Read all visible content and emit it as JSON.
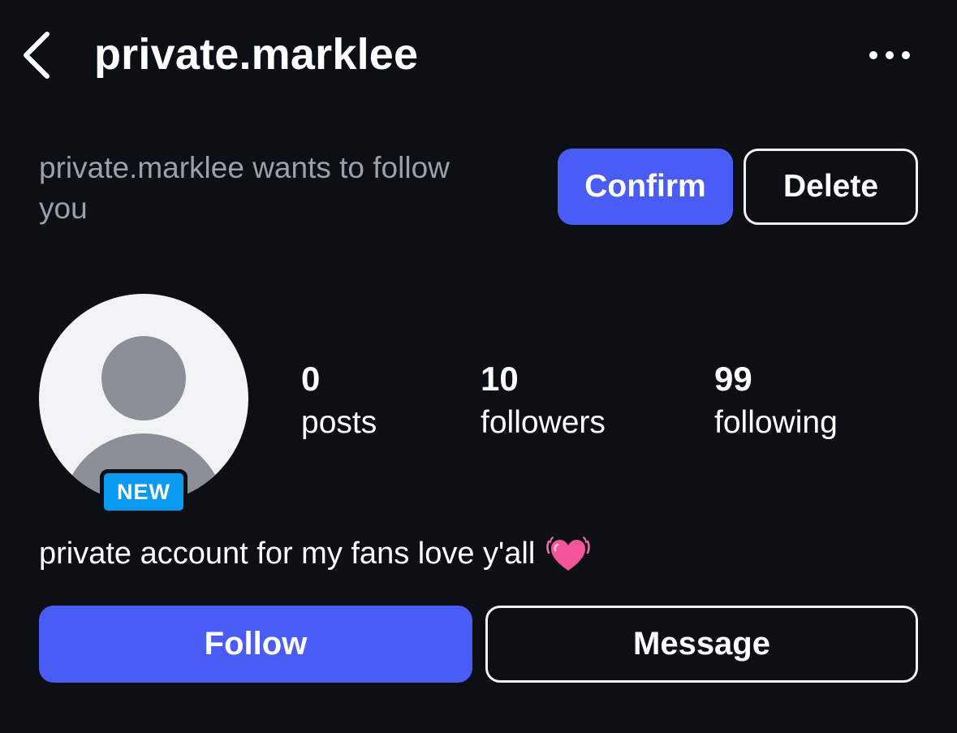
{
  "header": {
    "username": "private.marklee",
    "back_icon": "chevron-left-icon",
    "more_icon": "more-horizontal-icon"
  },
  "follow_request": {
    "text": "private.marklee wants to follow you",
    "confirm_label": "Confirm",
    "delete_label": "Delete"
  },
  "profile": {
    "avatar_icon": "default-avatar-icon",
    "new_badge": "NEW",
    "stats": {
      "posts_count": "0",
      "posts_label": "posts",
      "followers_count": "10",
      "followers_label": "followers",
      "following_count": "99",
      "following_label": "following"
    },
    "bio_text": "private account for my fans love y'all",
    "bio_emoji_icon": "beating-heart-icon"
  },
  "actions": {
    "follow_label": "Follow",
    "message_label": "Message"
  },
  "colors": {
    "background": "#0c0f14",
    "accent": "#4a5cf6",
    "badge": "#0a9af0",
    "secondary_text": "#9aa1ab"
  }
}
